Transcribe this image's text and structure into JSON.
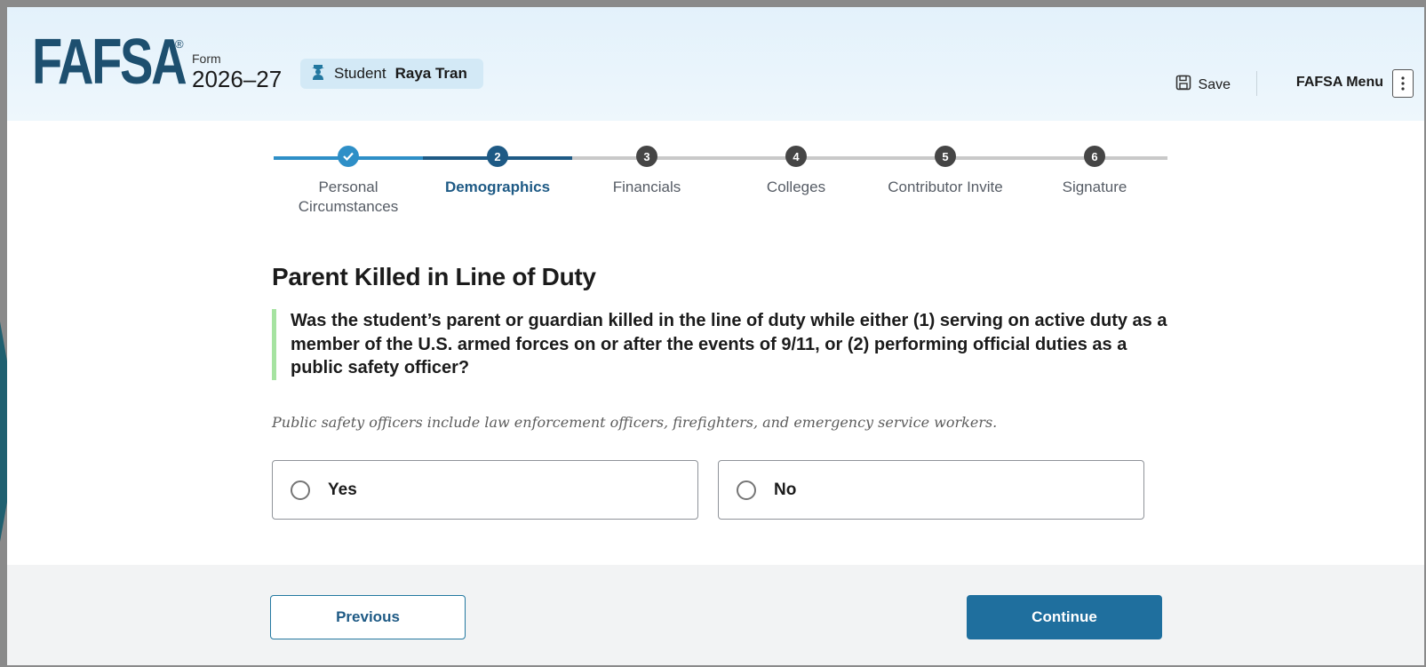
{
  "header": {
    "logo_text": "FAFSA",
    "logo_mark": "®",
    "form_label": "Form",
    "form_year": "2026–27",
    "student_role": "Student",
    "student_name": "Raya Tran",
    "student_icon": "graduate-icon",
    "save_label": "Save",
    "save_icon": "floppy-disk-icon",
    "menu_label": "FAFSA Menu",
    "menu_icon": "kebab-menu-icon"
  },
  "stepper": {
    "current_step": 2,
    "steps": [
      {
        "number": "1",
        "label": "Personal Circumstances",
        "status": "complete"
      },
      {
        "number": "2",
        "label": "Demographics",
        "status": "current"
      },
      {
        "number": "3",
        "label": "Financials",
        "status": "upcoming"
      },
      {
        "number": "4",
        "label": "Colleges",
        "status": "upcoming"
      },
      {
        "number": "5",
        "label": "Contributor Invite",
        "status": "upcoming"
      },
      {
        "number": "6",
        "label": "Signature",
        "status": "upcoming"
      }
    ]
  },
  "page": {
    "title": "Parent Killed in Line of Duty",
    "question": "Was the student’s parent or guardian killed in the line of duty while either (1) serving on active duty as a member of the U.S. armed forces on or after the events of 9/11, or (2) performing official duties as a public safety officer?",
    "hint": "Public safety officers include law enforcement officers, firefighters, and emergency service workers.",
    "options": [
      {
        "label": "Yes",
        "selected": false
      },
      {
        "label": "No",
        "selected": false
      }
    ]
  },
  "footer": {
    "previous_label": "Previous",
    "continue_label": "Continue"
  },
  "colors": {
    "brand": "#1d4f6f",
    "accent": "#1f6f9e",
    "complete": "#2e8fc7",
    "upcoming": "#454545",
    "track_active": "#2e8fc7",
    "track_current": "#1e5a85",
    "track_inactive": "#c9c9c9"
  }
}
